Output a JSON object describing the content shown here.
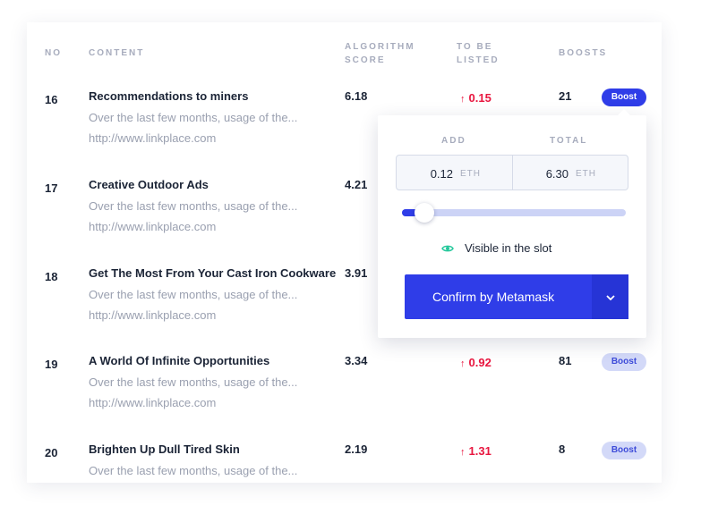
{
  "columns": {
    "no": "NO",
    "content": "CONTENT",
    "score_line1": "ALGORITHM",
    "score_line2": "SCORE",
    "listed_line1": "TO BE",
    "listed_line2": "LISTED",
    "boosts": "BOOSTS"
  },
  "rows": [
    {
      "no": "16",
      "title": "Recommendations to miners",
      "desc": "Over the last few months, usage of the...",
      "link": "http://www.linkplace.com",
      "score": "6.18",
      "listed": "0.15",
      "boosts": "21",
      "boost_label": "Boost"
    },
    {
      "no": "17",
      "title": "Creative Outdoor Ads",
      "desc": "Over the last few months, usage of the...",
      "link": "http://www.linkplace.com",
      "score": "4.21"
    },
    {
      "no": "18",
      "title": "Get The Most From Your Cast Iron Cookware",
      "desc": "Over the last few months, usage of the...",
      "link": "http://www.linkplace.com",
      "score": "3.91"
    },
    {
      "no": "19",
      "title": "A World Of Infinite Opportunities",
      "desc": "Over the last few months, usage of the...",
      "link": "http://www.linkplace.com",
      "score": "3.34",
      "listed": "0.92",
      "boosts": "81",
      "boost_label": "Boost"
    },
    {
      "no": "20",
      "title": "Brighten Up Dull Tired Skin",
      "desc": "Over the last few months, usage of the...",
      "score": "2.19",
      "listed": "1.31",
      "boosts": "8",
      "boost_label": "Boost"
    }
  ],
  "popover": {
    "add_label": "ADD",
    "total_label": "TOTAL",
    "add_value": "0.12",
    "total_value": "6.30",
    "unit": "ETH",
    "slider_fraction": 0.1,
    "visible_text": "Visible in the slot",
    "confirm_label": "Confirm by Metamask"
  },
  "icons": {
    "listed_arrow": "arrow-up-icon",
    "visible": "eye-icon",
    "dropdown": "chevron-down-icon"
  },
  "colors": {
    "accent": "#2f3de8",
    "accent_soft": "#d3d9f8",
    "negative": "#e8163f",
    "eye": "#22c79a",
    "muted": "#9aa0b0"
  }
}
